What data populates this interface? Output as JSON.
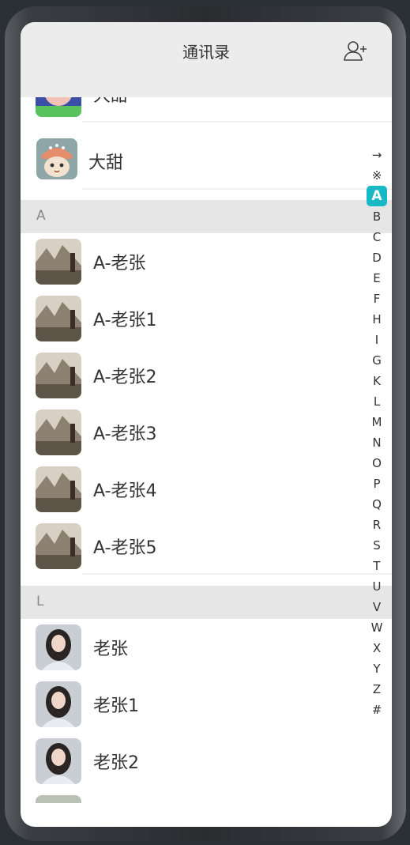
{
  "header": {
    "title": "通讯录",
    "add_icon": "add-contact-icon"
  },
  "top_contacts": [
    {
      "name": "大甜",
      "avatar": "anime-girl-avatar"
    },
    {
      "name": "大甜",
      "avatar": "cat-avatar"
    }
  ],
  "sections": [
    {
      "letter": "A",
      "contacts": [
        "A-老张",
        "A-老张1",
        "A-老张2",
        "A-老张3",
        "A-老张4",
        "A-老张5"
      ]
    },
    {
      "letter": "L",
      "contacts": [
        "老张",
        "老张1",
        "老张2"
      ]
    }
  ],
  "index_bar": {
    "letters": [
      "→",
      "※",
      "A",
      "B",
      "C",
      "D",
      "E",
      "F",
      "H",
      "I",
      "G",
      "K",
      "L",
      "M",
      "N",
      "O",
      "P",
      "Q",
      "R",
      "S",
      "T",
      "U",
      "V",
      "W",
      "X",
      "Y",
      "Z",
      "#"
    ],
    "active": "A"
  },
  "colors": {
    "accent": "#18b8c4",
    "header_bg": "#ececec",
    "section_bg": "#e6e6e6"
  }
}
